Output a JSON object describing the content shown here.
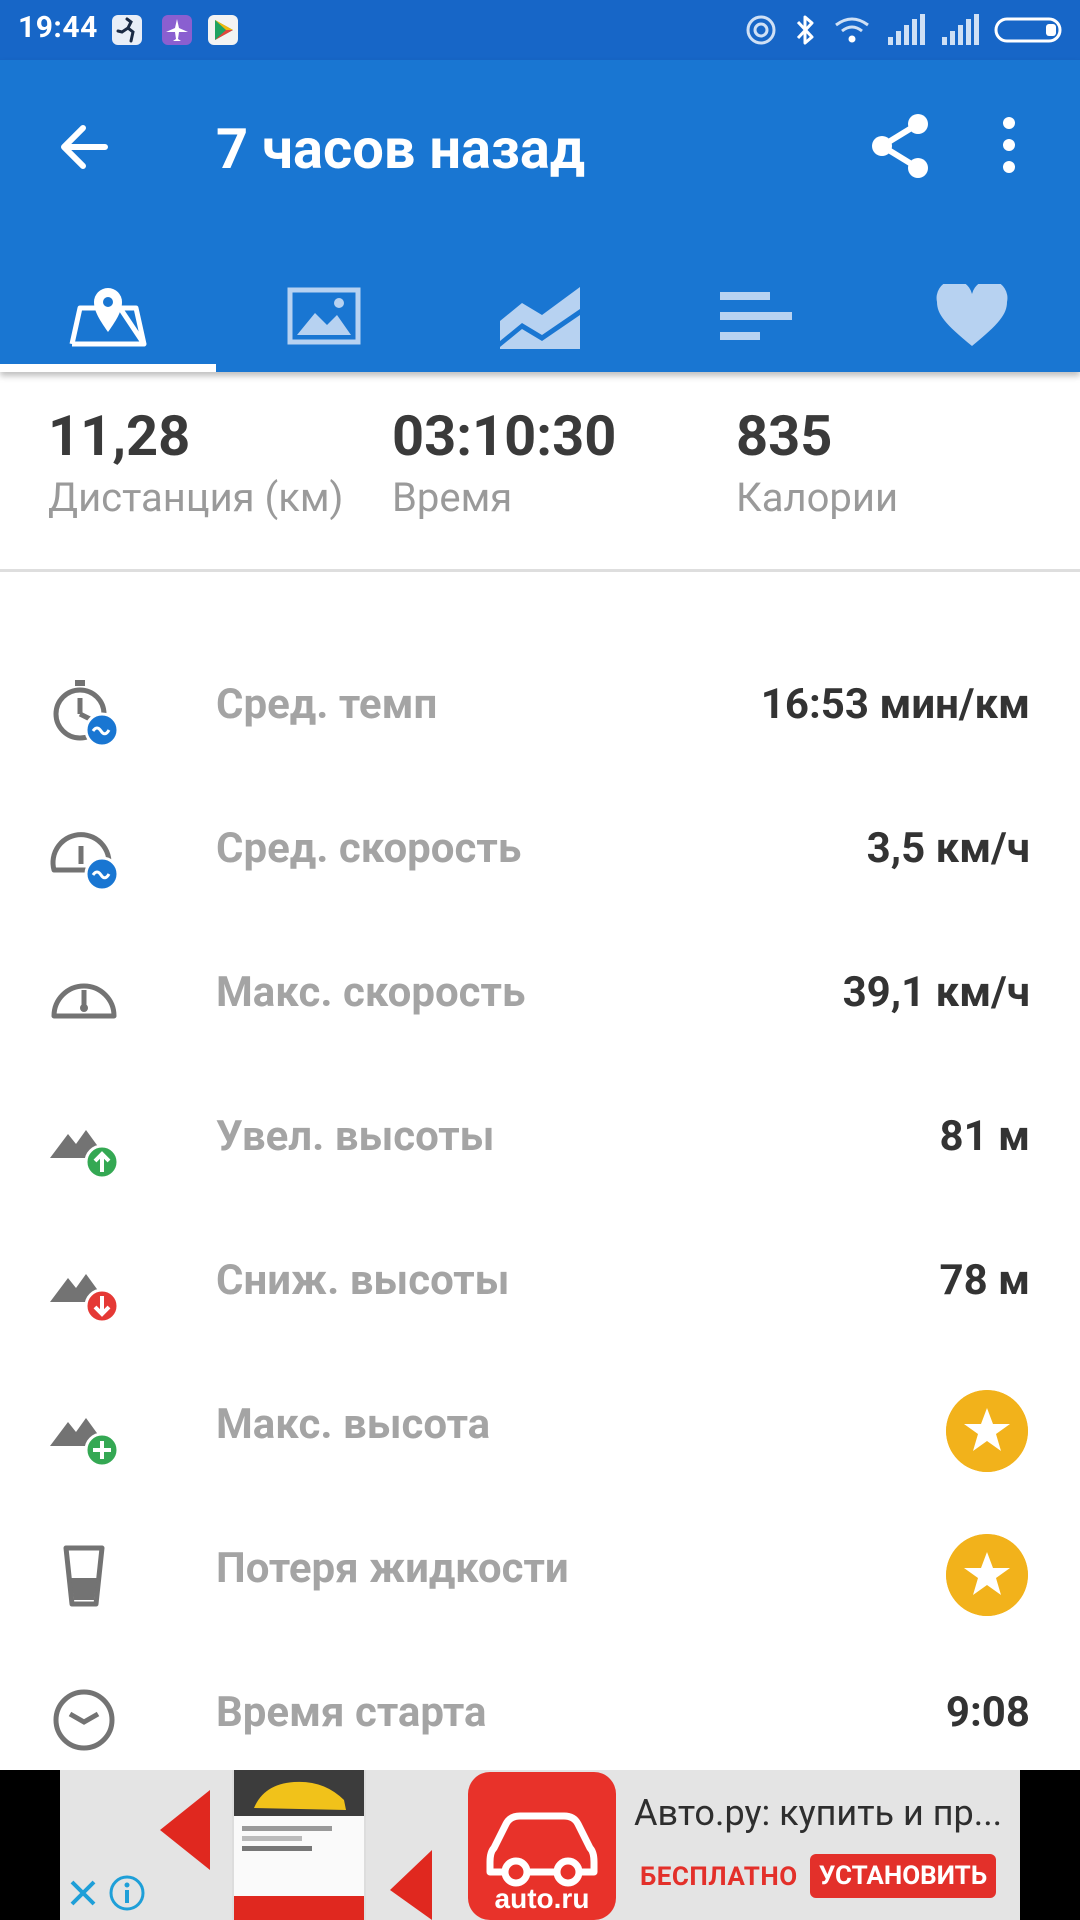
{
  "status_bar": {
    "time": "19:44"
  },
  "app_bar": {
    "title": "7 часов назад"
  },
  "tabs": [
    {
      "name": "map",
      "icon": "map-pin-icon",
      "active": true
    },
    {
      "name": "photos",
      "icon": "image-icon",
      "active": false
    },
    {
      "name": "charts",
      "icon": "area-chart-icon",
      "active": false
    },
    {
      "name": "splits",
      "icon": "bars-icon",
      "active": false
    },
    {
      "name": "heart-rate",
      "icon": "heart-icon",
      "active": false
    }
  ],
  "summary": {
    "distance": {
      "value": "11,28",
      "label": "Дистанция (км)"
    },
    "time": {
      "value": "03:10:30",
      "label": "Время"
    },
    "calories": {
      "value": "835",
      "label": "Калории"
    }
  },
  "metrics": [
    {
      "icon": "stopwatch-avg-icon",
      "label": "Сред. темп",
      "value": "16:53 мин/км"
    },
    {
      "icon": "speedometer-avg-icon",
      "label": "Сред. скорость",
      "value": "3,5 км/ч"
    },
    {
      "icon": "speedometer-icon",
      "label": "Макс. скорость",
      "value": "39,1 км/ч"
    },
    {
      "icon": "elevation-gain-icon",
      "label": "Увел. высоты",
      "value": "81 м"
    },
    {
      "icon": "elevation-loss-icon",
      "label": "Сниж. высоты",
      "value": "78 м"
    },
    {
      "icon": "elevation-max-icon",
      "label": "Макс. высота",
      "value": "",
      "premium": true
    },
    {
      "icon": "glass-icon",
      "label": "Потеря жидкости",
      "value": "",
      "premium": true
    },
    {
      "icon": "clock-icon",
      "label": "Время старта",
      "value": "9:08"
    }
  ],
  "ad": {
    "title": "Авто.ру: купить и пр...",
    "free_label": "БЕСПЛАТНО",
    "install_label": "УСТАНОВИТЬ",
    "logo_text": "auto.ru"
  },
  "colors": {
    "primary": "#1976d2",
    "status_bar": "#1766c7",
    "premium_star": "#f2b21b",
    "ad_red": "#e3302a"
  }
}
